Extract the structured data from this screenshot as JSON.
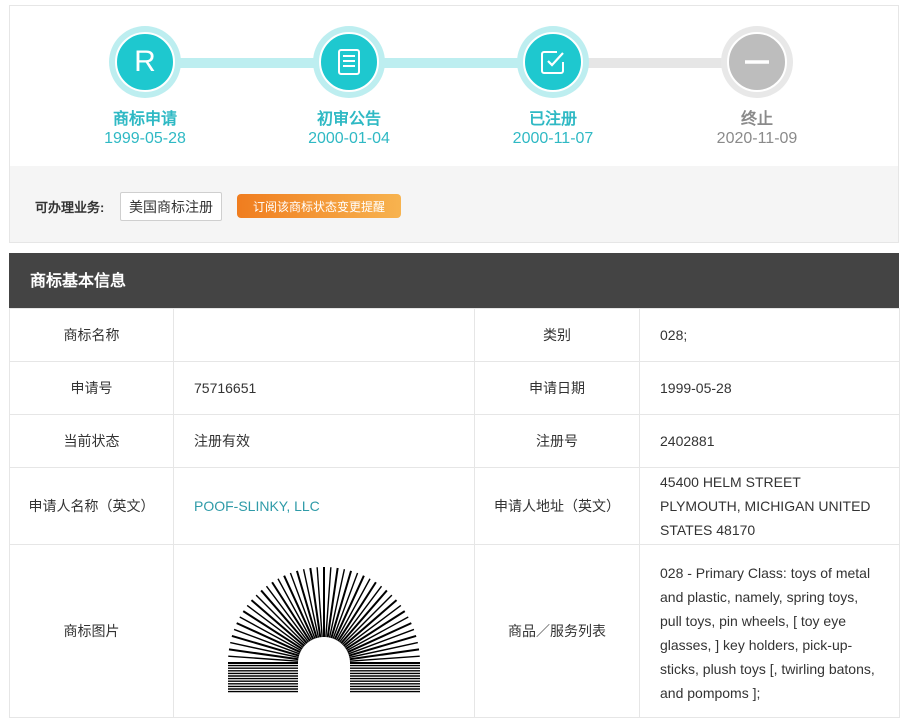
{
  "steps": [
    {
      "label": "商标申请",
      "date": "1999-05-28",
      "icon": "r-letter-icon",
      "letter": "R",
      "state": "done"
    },
    {
      "label": "初审公告",
      "date": "2000-01-04",
      "icon": "document-list-icon",
      "state": "done"
    },
    {
      "label": "已注册",
      "date": "2000-11-07",
      "icon": "checked-box-icon",
      "state": "done"
    },
    {
      "label": "终止",
      "date": "2020-11-09",
      "icon": "minus-circle-icon",
      "state": "inactive"
    }
  ],
  "business": {
    "label": "可办理业务:",
    "us_register_button": "美国商标注册",
    "subscribe_button": "订阅该商标状态变更提醒"
  },
  "section": {
    "title": "商标基本信息"
  },
  "info": {
    "name_label": "商标名称",
    "name_value": "",
    "class_label": "类别",
    "class_value": "028;",
    "app_no_label": "申请号",
    "app_no_value": "75716651",
    "app_date_label": "申请日期",
    "app_date_value": "1999-05-28",
    "status_label": "当前状态",
    "status_value": "注册有效",
    "reg_no_label": "注册号",
    "reg_no_value": "2402881",
    "applicant_name_label": "申请人名称（英文）",
    "applicant_name_value": "POOF-SLINKY, LLC",
    "applicant_address_label": "申请人地址（英文）",
    "applicant_address_value": "45400 HELM STREET PLYMOUTH, MICHIGAN UNITED STATES 48170",
    "image_label": "商标图片",
    "goods_label": "商品／服务列表",
    "goods_value": "028 - Primary Class: toys of metal and plastic, namely, spring toys, pull toys, pin wheels, [ toy eye glasses, ] key holders, pick-up-sticks, plush toys [, twirling batons, and pompoms ];"
  },
  "colors": {
    "accent": "#1ec8cf",
    "accent_light": "#bdeef0",
    "inactive": "#bdbdbd",
    "header_bg": "#444444",
    "link": "#2f9ba8",
    "orange_start": "#f07d1f",
    "orange_end": "#f7b34f"
  }
}
